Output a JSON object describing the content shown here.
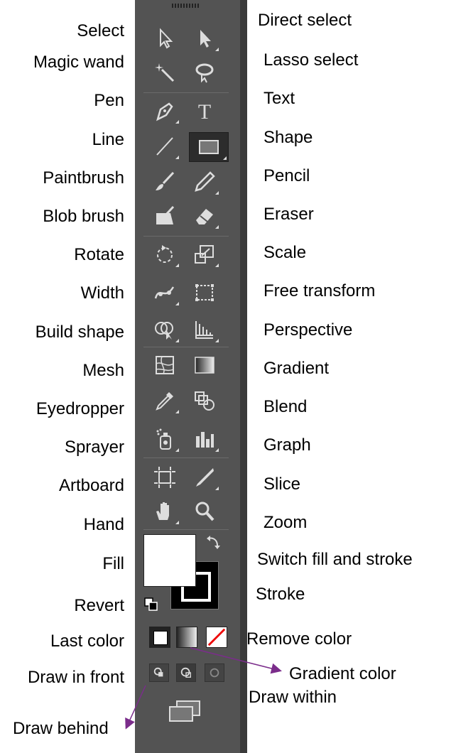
{
  "labels": {
    "left": [
      "Select",
      "Magic wand",
      "Pen",
      "Line",
      "Paintbrush",
      "Blob brush",
      "Rotate",
      "Width",
      "Build shape",
      "Mesh",
      "Eyedropper",
      "Sprayer",
      "Artboard",
      "Hand",
      "Fill",
      "Revert",
      "Last color",
      "Draw in front",
      "Draw behind"
    ],
    "right": [
      "Direct select",
      "Lasso select",
      "Text",
      "Shape",
      "Pencil",
      "Eraser",
      "Scale",
      "Free transform",
      "Perspective",
      "Gradient",
      "Blend",
      "Graph",
      "Slice",
      "Zoom",
      "Switch fill and stroke",
      "Stroke",
      "Remove color",
      "Gradient color",
      "Draw within"
    ]
  },
  "tools": [
    "select-tool",
    "direct-select-tool",
    "magic-wand-tool",
    "lasso-tool",
    "pen-tool",
    "type-tool",
    "line-tool",
    "rectangle-tool",
    "paintbrush-tool",
    "pencil-tool",
    "blob-brush-tool",
    "eraser-tool",
    "rotate-tool",
    "scale-tool",
    "width-tool",
    "free-transform-tool",
    "shape-builder-tool",
    "perspective-grid-tool",
    "mesh-tool",
    "gradient-tool",
    "eyedropper-tool",
    "blend-tool",
    "symbol-sprayer-tool",
    "graph-tool",
    "artboard-tool",
    "slice-tool",
    "hand-tool",
    "zoom-tool"
  ],
  "colors": {
    "toolbar": "#535353",
    "annotation_arrow": "#7b2d8b",
    "selected_tool": "#2c2c2c"
  }
}
